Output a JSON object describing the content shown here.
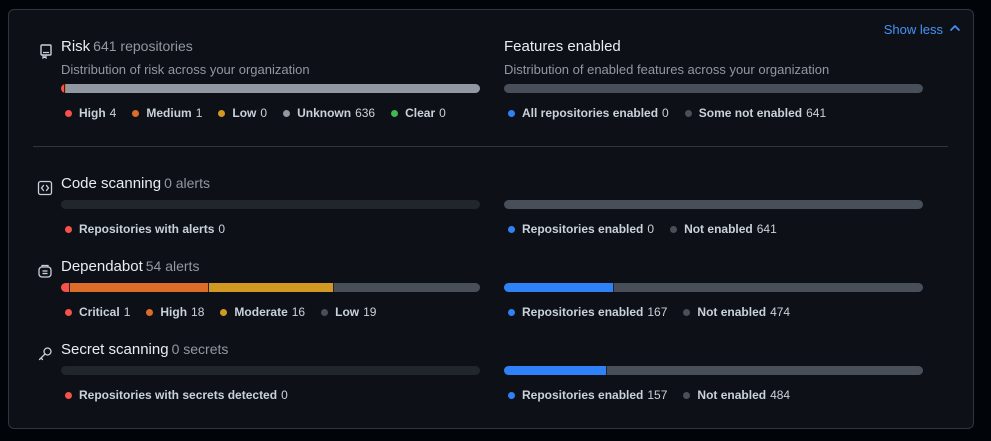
{
  "show_less": "Show less",
  "colors": {
    "red": "#f85149",
    "orange": "#db6d28",
    "yellow": "#d29922",
    "gray": "#9198a1",
    "green": "#3fb950",
    "blue": "#2f81f7",
    "darkgray": "#484f58",
    "track": "#21262d"
  },
  "risk": {
    "title": "Risk",
    "count": "641 repositories",
    "subtitle": "Distribution of risk across your organization",
    "segments": [
      {
        "pct": 0.62,
        "color": "#f85149"
      },
      {
        "pct": 0.16,
        "color": "#db6d28"
      },
      {
        "pct": 0,
        "color": "#d29922"
      },
      {
        "pct": 99.22,
        "color": "#9198a1"
      },
      {
        "pct": 0,
        "color": "#3fb950"
      }
    ],
    "legend": [
      {
        "label": "High",
        "value": "4",
        "color": "#f85149"
      },
      {
        "label": "Medium",
        "value": "1",
        "color": "#db6d28"
      },
      {
        "label": "Low",
        "value": "0",
        "color": "#d29922"
      },
      {
        "label": "Unknown",
        "value": "636",
        "color": "#9198a1"
      },
      {
        "label": "Clear",
        "value": "0",
        "color": "#3fb950"
      }
    ]
  },
  "features": {
    "title": "Features enabled",
    "subtitle": "Distribution of enabled features across your organization",
    "segments": [
      {
        "pct": 0,
        "color": "#2f81f7"
      },
      {
        "pct": 100,
        "color": "#484f58"
      }
    ],
    "legend": [
      {
        "label": "All repositories enabled",
        "value": "0",
        "color": "#2f81f7"
      },
      {
        "label": "Some not enabled",
        "value": "641",
        "color": "#484f58"
      }
    ]
  },
  "code_scanning": {
    "title": "Code scanning",
    "count": "0 alerts",
    "left_segments": [],
    "left_legend": [
      {
        "label": "Repositories with alerts",
        "value": "0",
        "color": "#f85149"
      }
    ],
    "right_segments": [
      {
        "pct": 0,
        "color": "#2f81f7"
      },
      {
        "pct": 100,
        "color": "#484f58"
      }
    ],
    "right_legend": [
      {
        "label": "Repositories enabled",
        "value": "0",
        "color": "#2f81f7"
      },
      {
        "label": "Not enabled",
        "value": "641",
        "color": "#484f58"
      }
    ]
  },
  "dependabot": {
    "title": "Dependabot",
    "count": "54 alerts",
    "left_segments": [
      {
        "pct": 1.85,
        "color": "#f85149"
      },
      {
        "pct": 33.33,
        "color": "#db6d28"
      },
      {
        "pct": 29.63,
        "color": "#d29922"
      },
      {
        "pct": 35.19,
        "color": "#484f58"
      }
    ],
    "left_legend": [
      {
        "label": "Critical",
        "value": "1",
        "color": "#f85149"
      },
      {
        "label": "High",
        "value": "18",
        "color": "#db6d28"
      },
      {
        "label": "Moderate",
        "value": "16",
        "color": "#d29922"
      },
      {
        "label": "Low",
        "value": "19",
        "color": "#484f58"
      }
    ],
    "right_segments": [
      {
        "pct": 26.05,
        "color": "#2f81f7"
      },
      {
        "pct": 73.95,
        "color": "#484f58"
      }
    ],
    "right_legend": [
      {
        "label": "Repositories enabled",
        "value": "167",
        "color": "#2f81f7"
      },
      {
        "label": "Not enabled",
        "value": "474",
        "color": "#484f58"
      }
    ]
  },
  "secret_scanning": {
    "title": "Secret scanning",
    "count": "0 secrets",
    "left_segments": [],
    "left_legend": [
      {
        "label": "Repositories with secrets detected",
        "value": "0",
        "color": "#f85149"
      }
    ],
    "right_segments": [
      {
        "pct": 24.49,
        "color": "#2f81f7"
      },
      {
        "pct": 75.51,
        "color": "#484f58"
      }
    ],
    "right_legend": [
      {
        "label": "Repositories enabled",
        "value": "157",
        "color": "#2f81f7"
      },
      {
        "label": "Not enabled",
        "value": "484",
        "color": "#484f58"
      }
    ]
  }
}
